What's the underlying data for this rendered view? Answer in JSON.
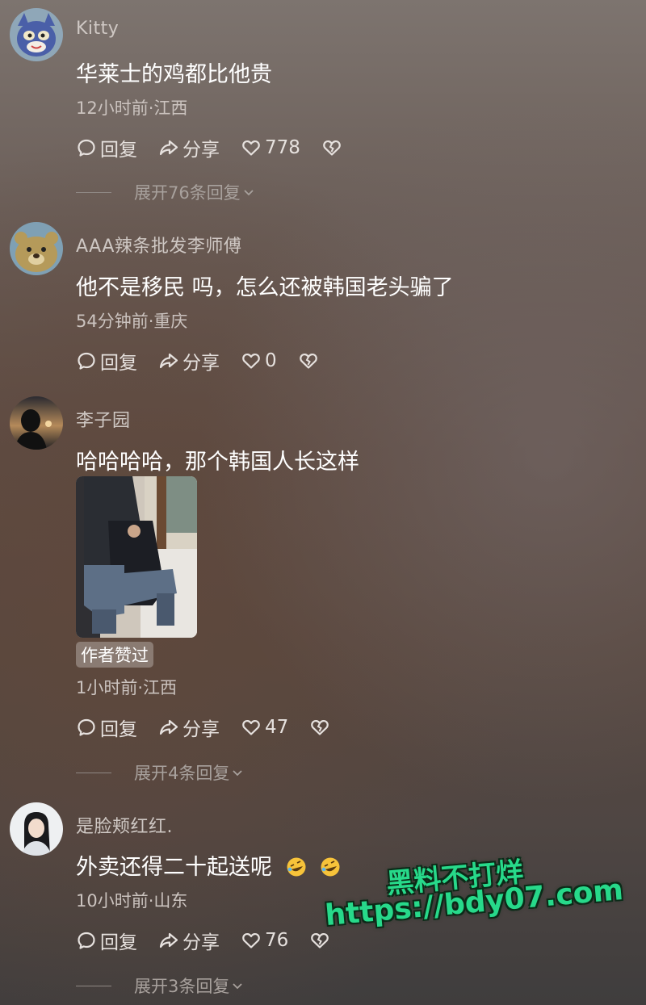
{
  "comments": [
    {
      "username": "Kitty",
      "text": "华莱士的鸡都比他贵",
      "meta": "12小时前·江西",
      "reply_label": "回复",
      "share_label": "分享",
      "likes": "778",
      "expand_label": "展开76条回复"
    },
    {
      "username": "AAA辣条批发李师傅",
      "text": "他不是移民 吗，怎么还被韩国老头骗了",
      "meta": "54分钟前·重庆",
      "reply_label": "回复",
      "share_label": "分享",
      "likes": "0"
    },
    {
      "username": "李子园",
      "text": "哈哈哈哈，那个韩国人长这样",
      "badge": "作者赞过",
      "meta": "1小时前·江西",
      "reply_label": "回复",
      "share_label": "分享",
      "likes": "47",
      "expand_label": "展开4条回复"
    },
    {
      "username": "是脸颊红红.",
      "text": "外卖还得二十起送呢",
      "meta": "10小时前·山东",
      "reply_label": "回复",
      "share_label": "分享",
      "likes": "76",
      "expand_label": "展开3条回复"
    }
  ],
  "watermark": {
    "line1": "黑料不打烊",
    "line2": "https://bdy07.com"
  },
  "colors": {
    "watermark": "#27d98a",
    "text": "#ffffff",
    "meta": "#cbc3bf"
  }
}
